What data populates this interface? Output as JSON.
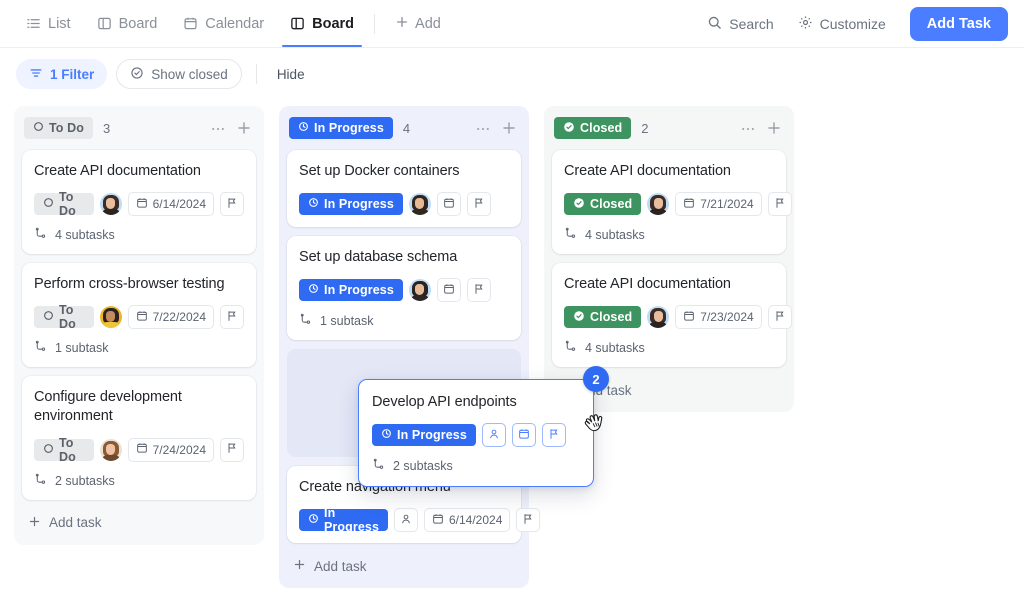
{
  "topbar": {
    "views": [
      {
        "label": "List",
        "icon": "list-icon",
        "active": false
      },
      {
        "label": "Board",
        "icon": "board-icon",
        "active": false
      },
      {
        "label": "Calendar",
        "icon": "calendar-icon",
        "active": false
      },
      {
        "label": "Board",
        "icon": "board-icon",
        "active": true
      }
    ],
    "add_view_label": "Add",
    "search_label": "Search",
    "customize_label": "Customize",
    "add_task_label": "Add Task",
    "accent_color": "#4a7dff"
  },
  "filterbar": {
    "filter_label": "1 Filter",
    "show_closed_label": "Show closed",
    "hide_label": "Hide"
  },
  "board": {
    "columns": [
      {
        "id": "todo",
        "status": "To Do",
        "status_color": "#e7e9eb",
        "count": "3",
        "add_task_label": "Add task",
        "cards": [
          {
            "title": "Create API documentation",
            "status": "To Do",
            "avatar": "av-a",
            "date": "6/14/2024",
            "subtasks": "4 subtasks",
            "has_date_text": true,
            "has_avatar": true
          },
          {
            "title": "Perform cross-browser testing",
            "status": "To Do",
            "avatar": "av-b",
            "date": "7/22/2024",
            "subtasks": "1 subtask",
            "has_date_text": true,
            "has_avatar": true
          },
          {
            "title": "Configure development environment",
            "status": "To Do",
            "avatar": "av-c",
            "date": "7/24/2024",
            "subtasks": "2 subtasks",
            "has_date_text": true,
            "has_avatar": true
          }
        ]
      },
      {
        "id": "progress",
        "status": "In Progress",
        "status_color": "#2f6bf2",
        "count": "4",
        "add_task_label": "Add task",
        "cards": [
          {
            "title": "Set up Docker containers",
            "status": "In Progress",
            "avatar": "av-d",
            "date": "",
            "subtasks": "",
            "has_date_text": false,
            "has_avatar": true
          },
          {
            "title": "Set up database schema",
            "status": "In Progress",
            "avatar": "av-e",
            "date": "",
            "subtasks": "1 subtask",
            "has_date_text": false,
            "has_avatar": true
          },
          {
            "title": "Create navigation menu",
            "status": "In Progress",
            "avatar": "",
            "date": "6/14/2024",
            "subtasks": "",
            "has_date_text": true,
            "has_avatar": false
          }
        ]
      },
      {
        "id": "closed",
        "status": "Closed",
        "status_color": "#3e9460",
        "count": "2",
        "add_task_label": "Add task",
        "cards": [
          {
            "title": "Create API documentation",
            "status": "Closed",
            "avatar": "av-a",
            "date": "7/21/2024",
            "subtasks": "4 subtasks",
            "has_date_text": true,
            "has_avatar": true
          },
          {
            "title": "Create API documentation",
            "status": "Closed",
            "avatar": "av-a",
            "date": "7/23/2024",
            "subtasks": "4 subtasks",
            "has_date_text": true,
            "has_avatar": true
          }
        ]
      }
    ]
  },
  "drag": {
    "card_title": "Develop API endpoints",
    "card_status": "In Progress",
    "card_subtasks": "2 subtasks",
    "badge_count": "2",
    "cursor": "grabbing-hand-cursor"
  }
}
